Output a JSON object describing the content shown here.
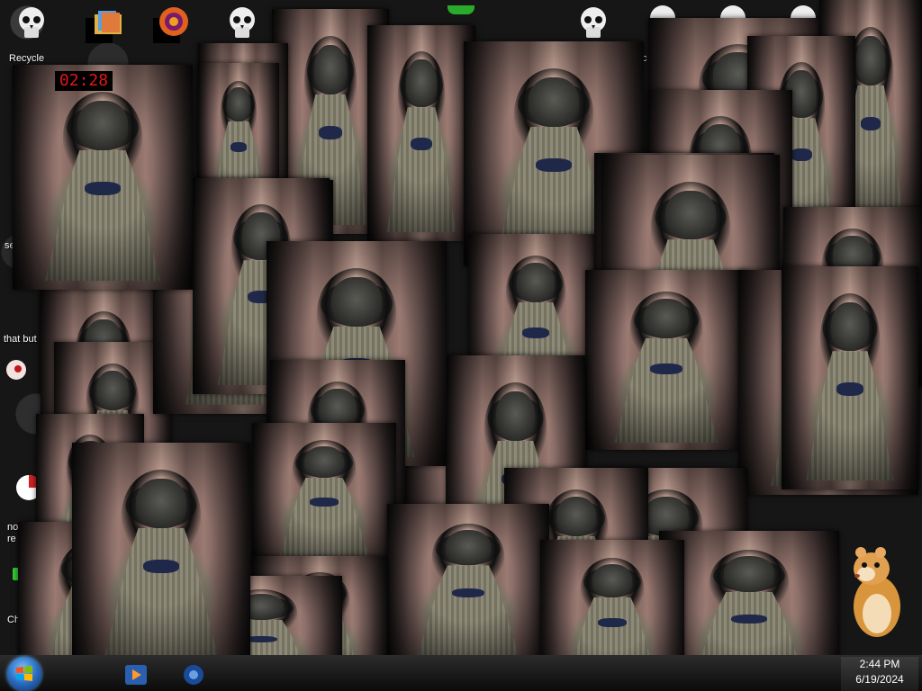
{
  "desktop": {
    "labels": {
      "recycle": "Recycle",
      "se": "se",
      "that_but": "that but",
      "no": "no",
      "re": "re",
      "ch": "Ch",
      "c": "c"
    }
  },
  "timer": {
    "value": "02:28",
    "color": "#e01818"
  },
  "tray": {
    "time": "2:44 PM",
    "date": "6/19/2024"
  },
  "icons": {
    "skull": "skull-icon",
    "recycle_bin": "recycle-bin-icon",
    "folder": "folder-icon",
    "firefox": "firefox-like-icon",
    "start": "windows-start-icon",
    "media_player": "media-player-icon",
    "hamster": "hamster-icon",
    "eye": "eye-icon"
  },
  "colors": {
    "taskbar": "#0b0b0b",
    "timer_bg": "#000000"
  }
}
